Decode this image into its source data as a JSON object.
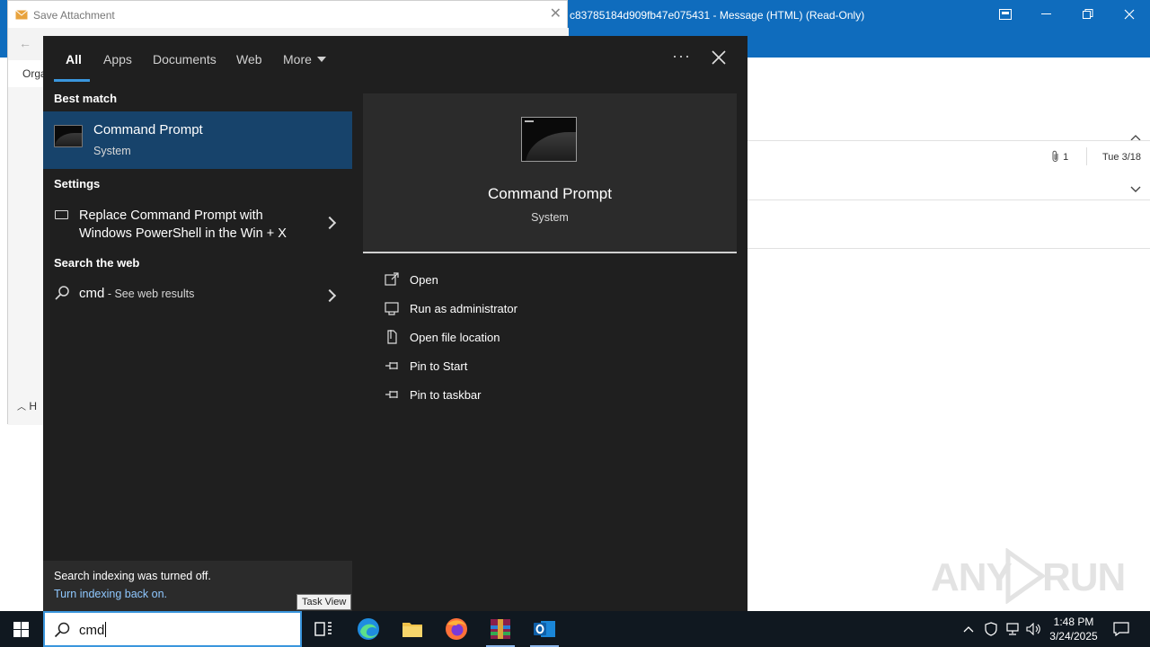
{
  "outlook": {
    "title": "c83785184d909fb47e075431  -  Message (HTML) (Read-Only)",
    "attachment_count": "1",
    "date": "Tue 3/18"
  },
  "save_dialog": {
    "title": "Save Attachment",
    "org_label": "Orga",
    "h_label": "H"
  },
  "flyout": {
    "tabs": [
      "All",
      "Apps",
      "Documents",
      "Web",
      "More"
    ],
    "more_options": "···",
    "best_match_heading": "Best match",
    "best_match": {
      "title": "Command Prompt",
      "subtitle": "System"
    },
    "settings_heading": "Settings",
    "setting_item": "Replace Command Prompt with Windows PowerShell in the Win + X",
    "web_heading": "Search the web",
    "web_item": {
      "query": "cmd",
      "suffix": " - See web results"
    },
    "indexing": {
      "message": "Search indexing was turned off.",
      "link": "Turn indexing back on."
    },
    "preview": {
      "title": "Command Prompt",
      "subtitle": "System",
      "actions": [
        {
          "label": "Open",
          "icon": "open-icon"
        },
        {
          "label": "Run as administrator",
          "icon": "shield-icon"
        },
        {
          "label": "Open file location",
          "icon": "file-location-icon"
        },
        {
          "label": "Pin to Start",
          "icon": "pin-icon"
        },
        {
          "label": "Pin to taskbar",
          "icon": "pin-icon"
        }
      ]
    }
  },
  "taskbar": {
    "search_value": "cmd",
    "tooltip": "Task View",
    "time": "1:48 PM",
    "date": "3/24/2025"
  },
  "watermark": {
    "left": "ANY",
    "right": "RUN"
  }
}
